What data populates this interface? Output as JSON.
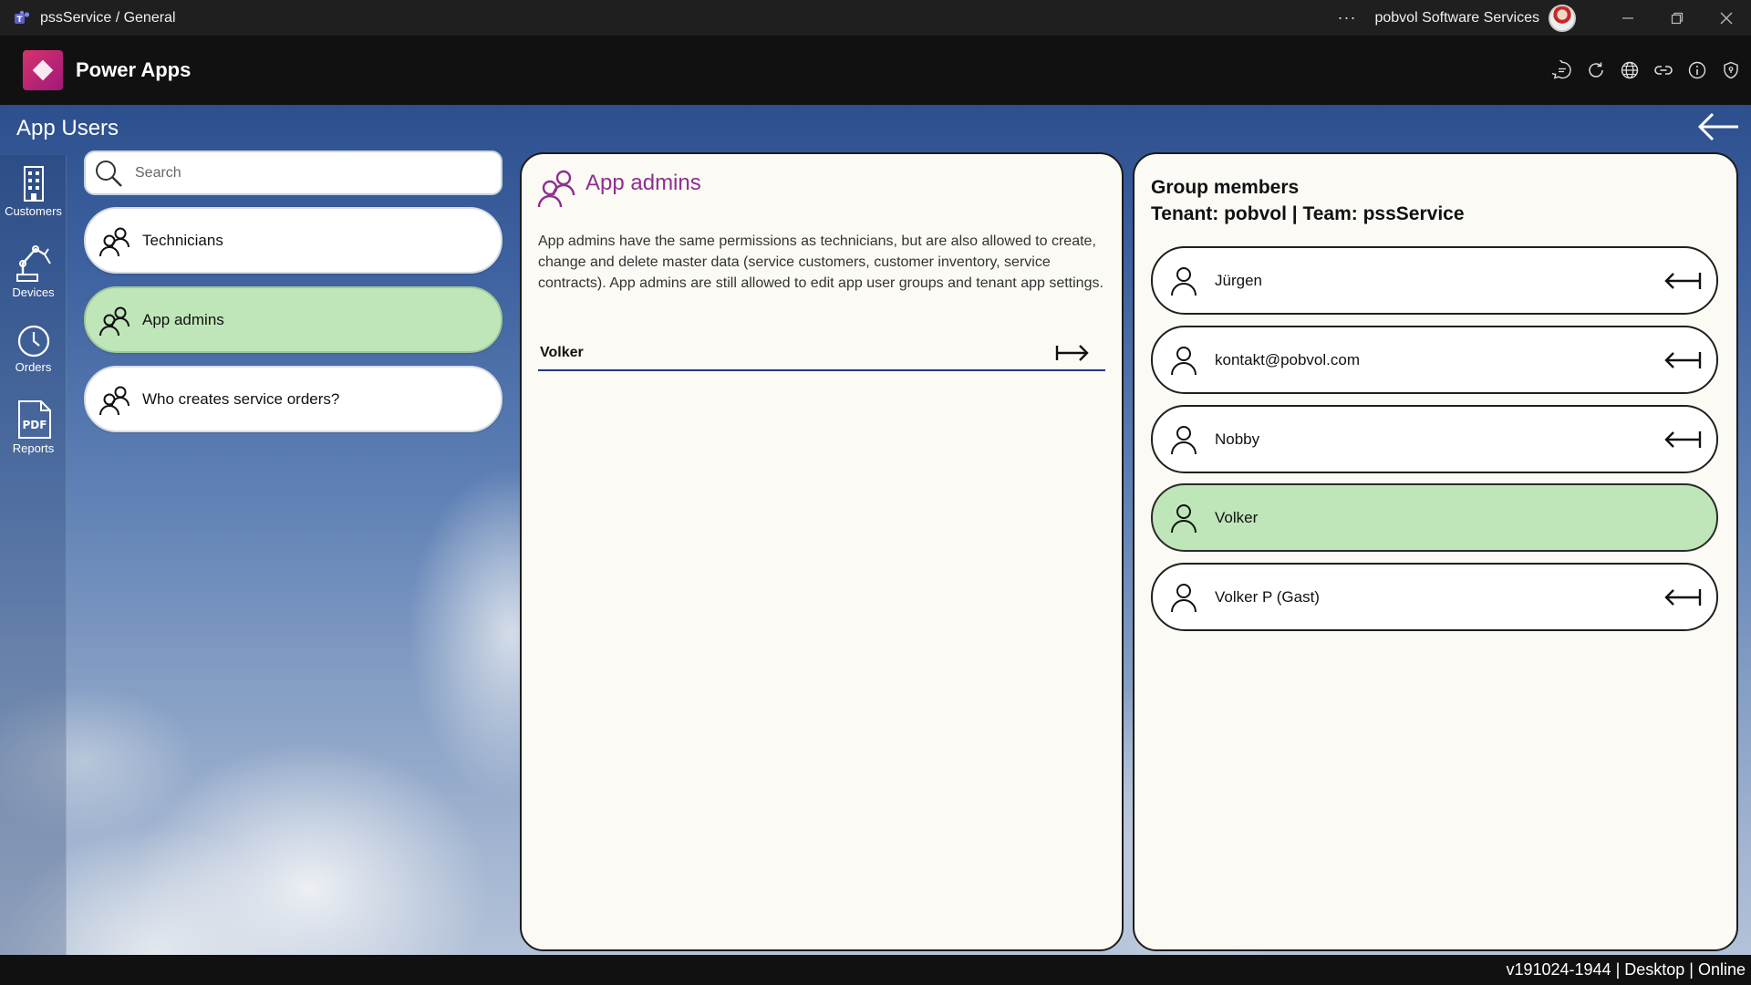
{
  "window": {
    "title": "pssService / General",
    "org_name": "pobvol Software Services",
    "more_label": "···"
  },
  "app": {
    "name": "Power Apps",
    "header_icons": [
      "chat-icon",
      "refresh-icon",
      "globe-icon",
      "link-icon",
      "info-icon",
      "shield-icon"
    ]
  },
  "screen": {
    "title": "App Users"
  },
  "nav": [
    {
      "label": "Customers",
      "icon": "building-icon"
    },
    {
      "label": "Devices",
      "icon": "robot-arm-icon"
    },
    {
      "label": "Orders",
      "icon": "clock-icon"
    },
    {
      "label": "Reports",
      "icon": "pdf-icon"
    }
  ],
  "search": {
    "placeholder": "Search",
    "value": ""
  },
  "groups": [
    {
      "label": "Technicians",
      "active": false
    },
    {
      "label": "App admins",
      "active": true
    },
    {
      "label": "Who creates service orders?",
      "active": false
    }
  ],
  "detail": {
    "title": "App admins",
    "description": "App admins have the same permissions as technicians, but are also allowed to create, change and delete master data (service customers, customer inventory, service contracts). App admins are still allowed to edit app user groups and tenant app settings.",
    "candidates": [
      {
        "name": "Volker"
      }
    ]
  },
  "members": {
    "title_line1": "Group members",
    "title_line2": "Tenant: pobvol | Team: pssService",
    "items": [
      {
        "name": "Jürgen",
        "active": false
      },
      {
        "name": "kontakt@pobvol.com",
        "active": false
      },
      {
        "name": "Nobby",
        "active": false
      },
      {
        "name": "Volker",
        "active": true
      },
      {
        "name": "Volker P (Gast)",
        "active": false
      }
    ]
  },
  "status": {
    "text": "v191024-1944 | Desktop | Online"
  },
  "colors": {
    "accent_purple": "#8e2f8e",
    "active_green": "#bfe6b8",
    "underline_blue": "#1d3a7a"
  }
}
